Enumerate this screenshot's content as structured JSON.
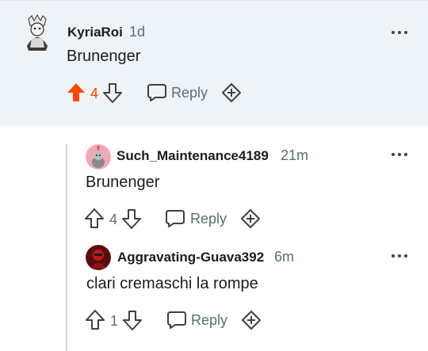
{
  "comments": [
    {
      "author": "KyriaRoi",
      "age": "1d",
      "text": "Brunenger",
      "score": "4",
      "upvoted": true,
      "reply_label": "Reply"
    },
    {
      "author": "Such_Maintenance4189",
      "age": "21m",
      "text": "Brunenger",
      "score": "4",
      "upvoted": false,
      "reply_label": "Reply"
    },
    {
      "author": "Aggravating-Guava392",
      "age": "6m",
      "text": "clari cremaschi la rompe",
      "score": "1",
      "upvoted": false,
      "reply_label": "Reply"
    }
  ],
  "colors": {
    "upvote_active": "#ff4500",
    "meta_gray": "#576f76",
    "top_comment_bg": "#eef3f8"
  },
  "icons": [
    "more-options-icon",
    "upvote-icon",
    "downvote-icon",
    "reply-bubble-icon",
    "award-plus-icon"
  ]
}
